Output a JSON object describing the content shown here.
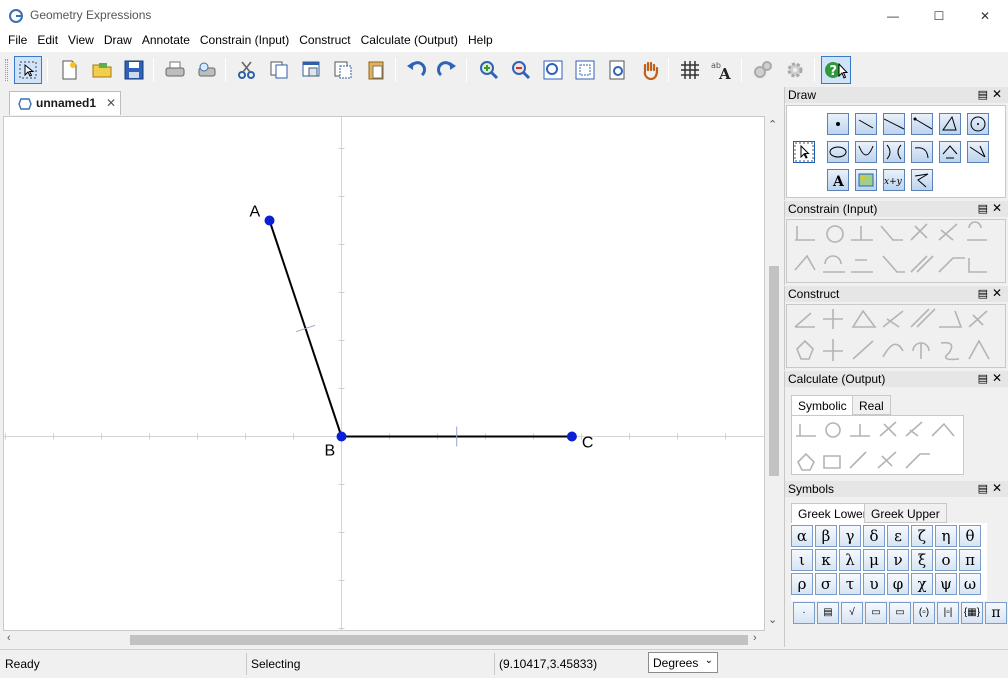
{
  "window": {
    "title": "Geometry Expressions",
    "minimize": "—",
    "maximize": "☐",
    "close": "✕"
  },
  "menu": [
    "File",
    "Edit",
    "View",
    "Draw",
    "Annotate",
    "Constrain (Input)",
    "Construct",
    "Calculate (Output)",
    "Help"
  ],
  "document": {
    "tab_label": "unnamed1",
    "tab_close": "✕",
    "points": [
      {
        "label": "A",
        "x": -1.5,
        "y": 4.5
      },
      {
        "label": "B",
        "x": 0,
        "y": 0
      },
      {
        "label": "C",
        "x": 4.8,
        "y": 0
      }
    ]
  },
  "panels": {
    "draw": {
      "title": "Draw"
    },
    "constrain": {
      "title": "Constrain (Input)"
    },
    "construct": {
      "title": "Construct"
    },
    "calculate": {
      "title": "Calculate (Output)",
      "tabs": [
        "Symbolic",
        "Real"
      ]
    },
    "symbols": {
      "title": "Symbols",
      "tabs": [
        "Greek Lower",
        "Greek Upper"
      ],
      "rows": [
        [
          "α",
          "β",
          "γ",
          "δ",
          "ε",
          "ζ",
          "η",
          "θ"
        ],
        [
          "ι",
          "κ",
          "λ",
          "μ",
          "ν",
          "ξ",
          "ο",
          "π"
        ],
        [
          "ρ",
          "σ",
          "τ",
          "υ",
          "φ",
          "χ",
          "ψ",
          "ω"
        ]
      ],
      "pi": "π"
    }
  },
  "status": {
    "ready": "Ready",
    "mode": "Selecting",
    "coords": "(9.10417,3.45833)",
    "units": "Degrees"
  }
}
